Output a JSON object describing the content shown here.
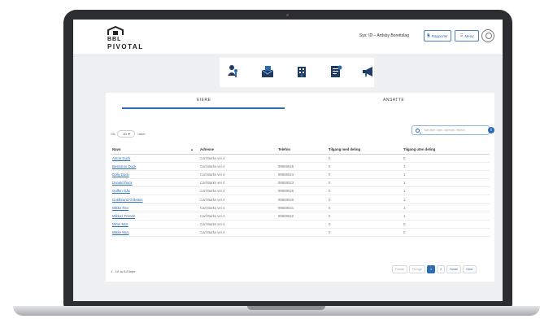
{
  "header": {
    "logo_line1": "BBL",
    "logo_line2": "PIVOTAL",
    "sysinfo": "Sys: ID – Ardsby Borettslag",
    "report_label": "Rapporter",
    "menu_label": "Meny"
  },
  "tabs": [
    {
      "label": "EIERE",
      "active": true
    },
    {
      "label": "ANSATTE",
      "active": false
    }
  ],
  "toolbar": {
    "show_label": "Vis",
    "page_size": "10",
    "rows_label": "rader",
    "search_placeholder": "Søk etter navn, adresse, telefon"
  },
  "table": {
    "columns": [
      "Navn",
      "Adresse",
      "Telefon",
      "Tilgang med deling",
      "Tilgang uten deling"
    ],
    "rows": [
      [
        "Anton Duck",
        "Carl Barks vei 4",
        "",
        "0",
        "0"
      ],
      [
        "Bestemor Duck",
        "Carl Barks vei 4",
        "99659525",
        "0",
        "1"
      ],
      [
        "Dolly Duck",
        "Carl Barks vei 4",
        "99659524",
        "0",
        "1"
      ],
      [
        "Donald Duck",
        "Carl Barks vei 4",
        "99659523",
        "0",
        "1"
      ],
      [
        "Guffen Gås",
        "Carl Barks vei 4",
        "99659526",
        "0",
        "1"
      ],
      [
        "Guldbrand Gråstein",
        "Carl Barks vei 4",
        "99659546",
        "0",
        "1"
      ],
      [
        "Mikke Rev",
        "Carl Barks vei 4",
        "99659521",
        "0",
        "1"
      ],
      [
        "Mikkes Frende",
        "Carl Barks vei 4",
        "99659522",
        "0",
        "1"
      ],
      [
        "Minni Mus",
        "Carl Barks vei 4",
        "",
        "0",
        "0"
      ],
      [
        "Mikke Mus",
        "Carl Barks vei 4",
        "",
        "0",
        "0"
      ]
    ]
  },
  "footer": {
    "count_text": "1 - 10 av 12 linjer",
    "pager": [
      "Første",
      "Forrige",
      "1",
      "2",
      "Neste",
      "Siste"
    ],
    "active_page": "1"
  },
  "colors": {
    "accent": "#2b6cb0",
    "link": "#2d6db5"
  },
  "icons": [
    "user-key-icon",
    "mail-icon",
    "building-icon",
    "document-list-icon",
    "megaphone-icon"
  ]
}
